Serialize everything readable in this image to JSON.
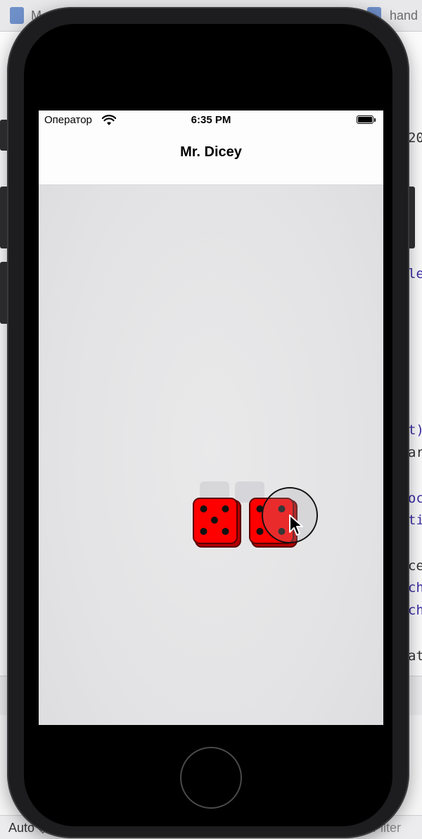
{
  "xcode": {
    "tab_left": "M...",
    "tab_right": "hand",
    "code_fragments": [
      {
        "text": "20",
        "color": "#333333"
      },
      {
        "text": "le",
        "color": "#3b2ea3"
      },
      {
        "text": "t)",
        "color": "#3b2ea3"
      },
      {
        "text": "ar",
        "color": "#333333"
      },
      {
        "text": "oc",
        "color": "#3b2ea3"
      },
      {
        "text": "ti",
        "color": "#3b2ea3"
      },
      {
        "text": "ce",
        "color": "#333333"
      },
      {
        "text": "ch",
        "color": "#3b2ea3"
      },
      {
        "text": "ch",
        "color": "#3b2ea3"
      },
      {
        "text": "at",
        "color": "#333333"
      }
    ],
    "footer": {
      "scope_select": "Auto ◇",
      "filter_label": "Filter"
    }
  },
  "status_bar": {
    "carrier": "Оператор",
    "time": "6:35 PM"
  },
  "nav": {
    "title": "Mr. Dicey"
  },
  "dice": [
    {
      "value": 5,
      "color": "#ff0000"
    },
    {
      "value": 4,
      "color": "#ff0000"
    }
  ],
  "colors": {
    "die_red": "#ff0000",
    "pip": "#111111",
    "nav_background": "#fdfdfe"
  }
}
